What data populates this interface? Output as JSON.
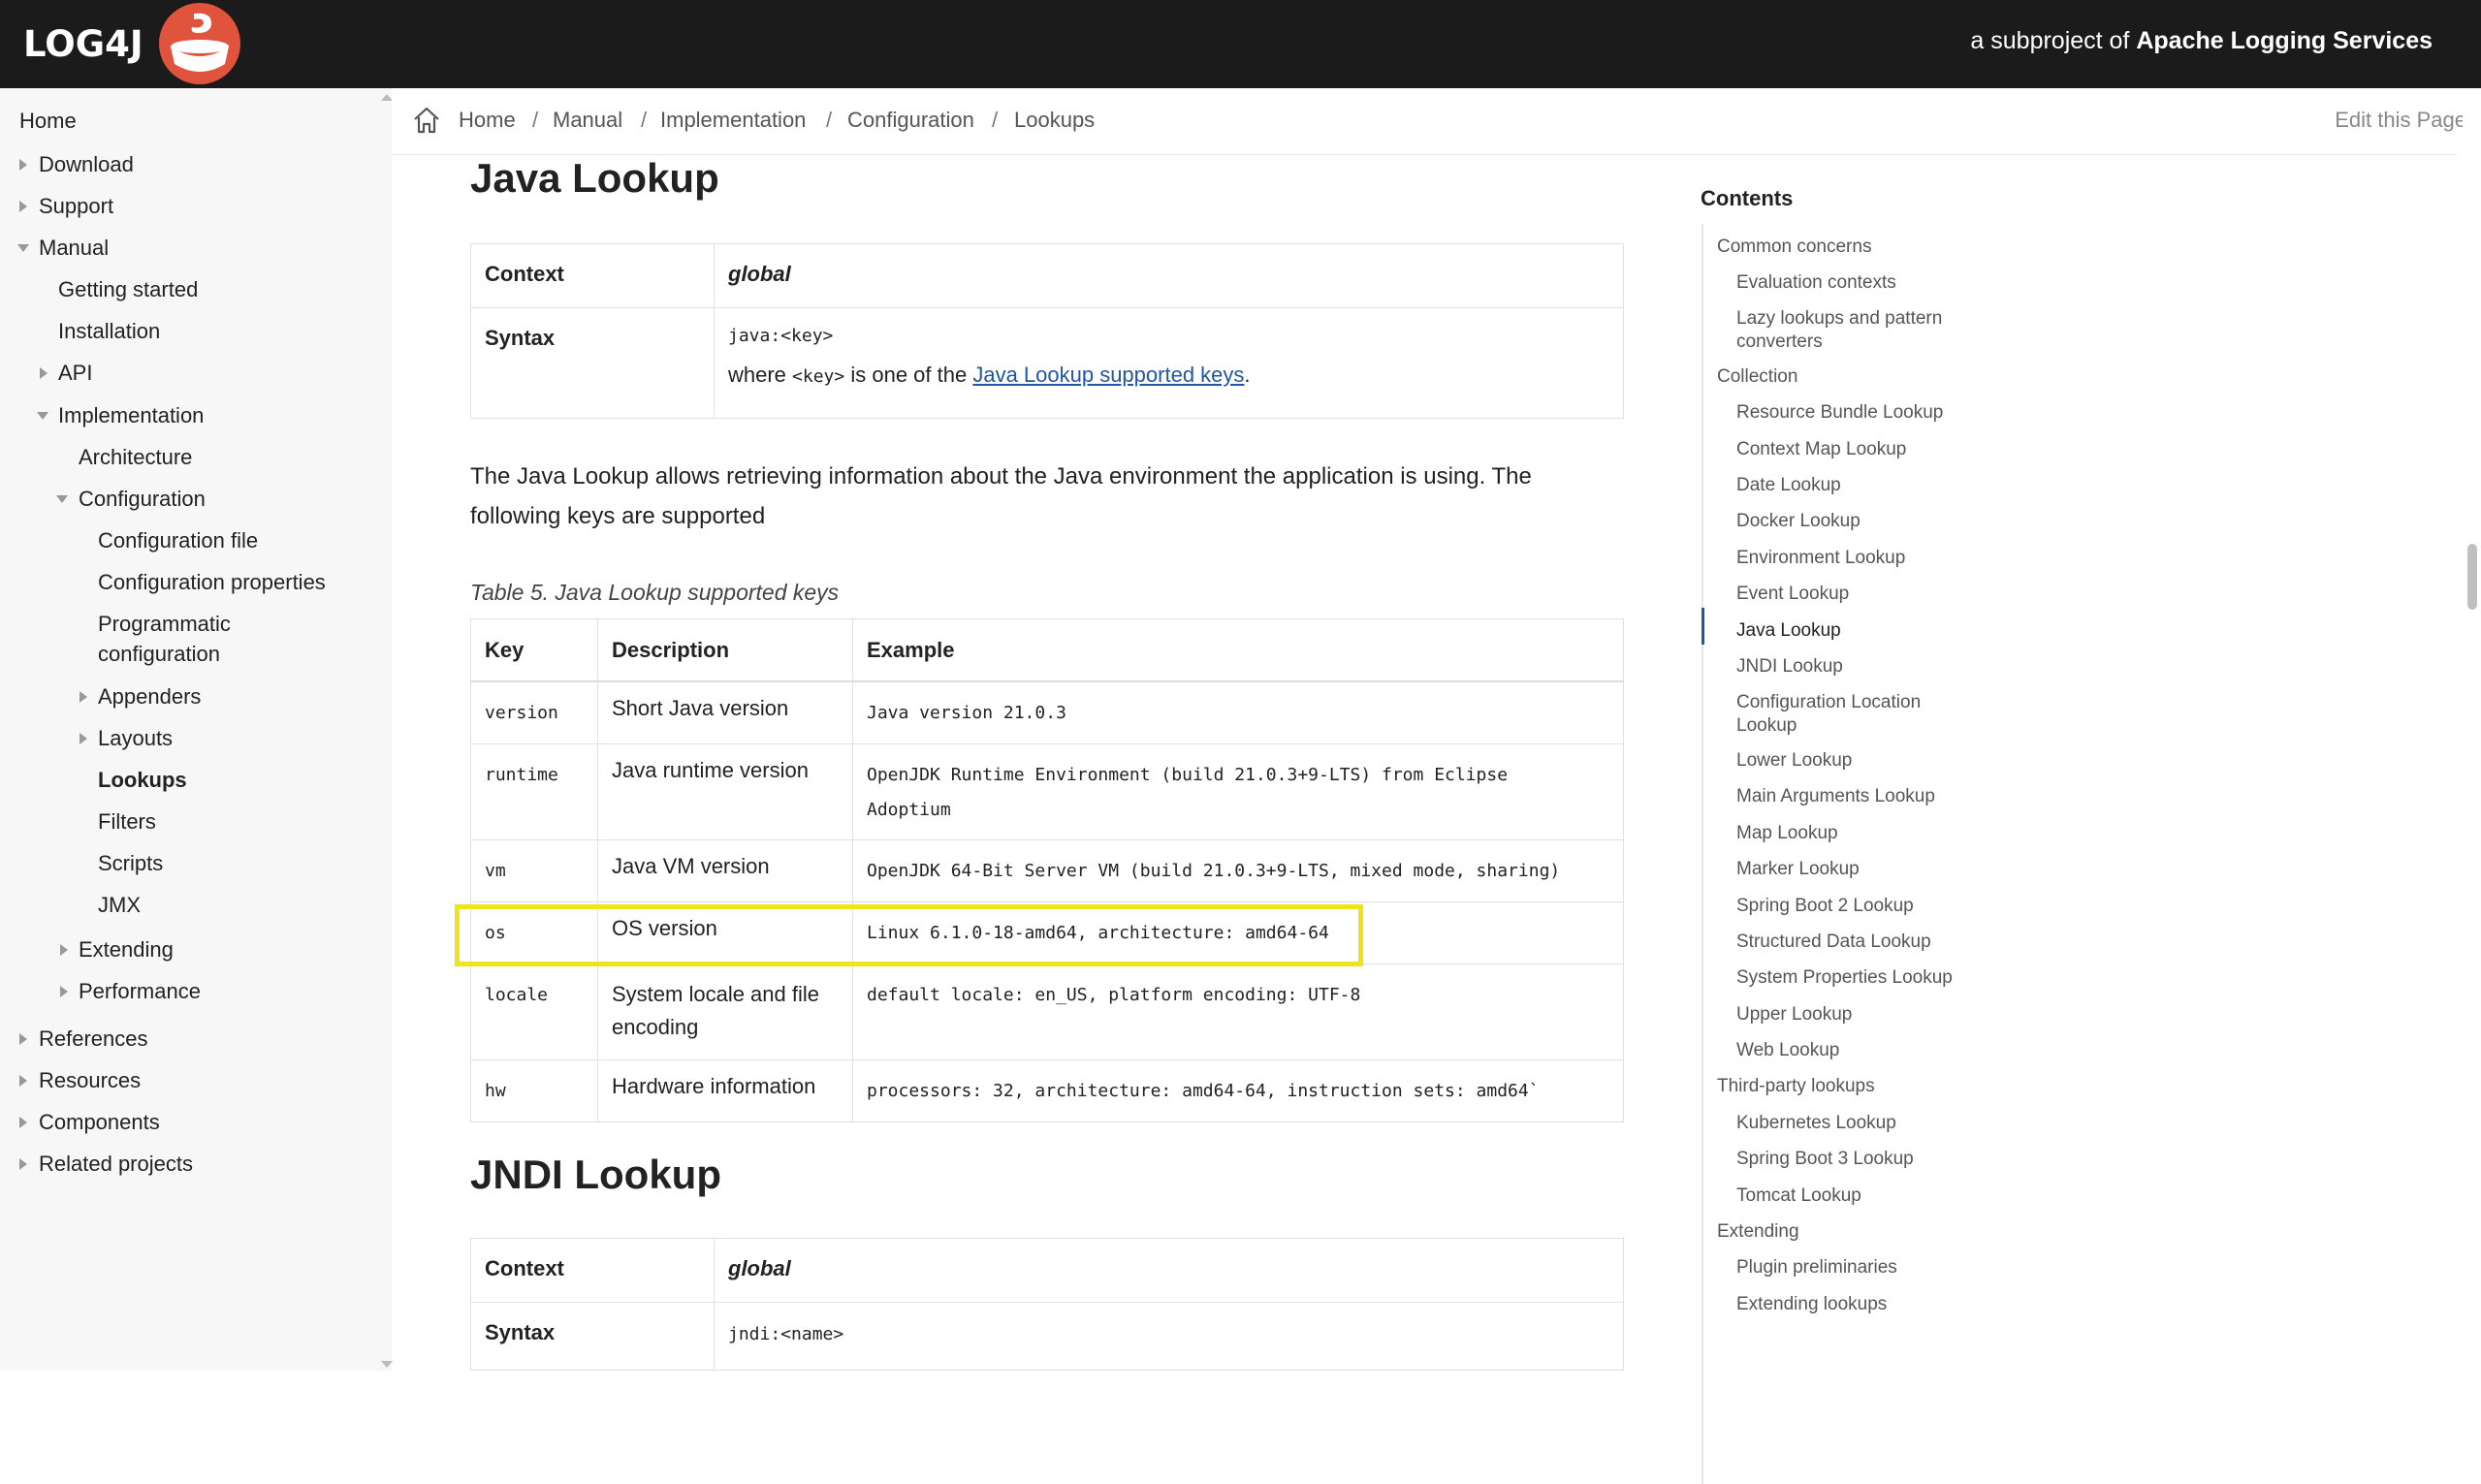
{
  "header": {
    "logo_text": "LOG4J",
    "subproject_prefix": "a subproject of ",
    "subproject_name": "Apache Logging Services"
  },
  "sidebar": {
    "home": "Home",
    "download": "Download",
    "support": "Support",
    "manual": "Manual",
    "getting_started": "Getting started",
    "installation": "Installation",
    "api": "API",
    "implementation": "Implementation",
    "architecture": "Architecture",
    "configuration": "Configuration",
    "configuration_file": "Configuration file",
    "configuration_properties": "Configuration properties",
    "programmatic_1": "Programmatic",
    "programmatic_2": "configuration",
    "appenders": "Appenders",
    "layouts": "Layouts",
    "lookups": "Lookups",
    "filters": "Filters",
    "scripts": "Scripts",
    "jmx": "JMX",
    "extending": "Extending",
    "performance": "Performance",
    "references": "References",
    "resources": "Resources",
    "components": "Components",
    "related_projects": "Related projects"
  },
  "breadcrumb": {
    "items": [
      "Home",
      "Manual",
      "Implementation",
      "Configuration",
      "Lookups"
    ],
    "separator": "/",
    "edit_page": "Edit this Page"
  },
  "java_lookup": {
    "title": "Java Lookup",
    "context_label": "Context",
    "context_value": "global",
    "syntax_label": "Syntax",
    "syntax_code": "java:<key>",
    "where_prefix": "where ",
    "where_code": "<key>",
    "where_middle": " is one of the ",
    "where_link": "Java Lookup supported keys",
    "where_suffix": ".",
    "description_line1": "The Java Lookup allows retrieving information about the Java environment the application is using. The",
    "description_line2": "following keys are supported",
    "table_caption": "Table 5. Java Lookup supported keys",
    "table_headers": [
      "Key",
      "Description",
      "Example"
    ],
    "rows": [
      {
        "key": "version",
        "desc": "Short Java version",
        "example": "Java version 21.0.3"
      },
      {
        "key": "runtime",
        "desc": "Java runtime version",
        "example": "OpenJDK Runtime Environment (build 21.0.3+9-LTS) from Eclipse",
        "example2": "Adoptium"
      },
      {
        "key": "vm",
        "desc": "Java VM version",
        "example": "OpenJDK 64-Bit Server VM (build 21.0.3+9-LTS, mixed mode, sharing)"
      },
      {
        "key": "os",
        "desc": "OS version",
        "example": "Linux 6.1.0-18-amd64, architecture: amd64-64"
      },
      {
        "key": "locale",
        "desc": "System locale and file",
        "desc2": "encoding",
        "example": "default locale: en_US, platform encoding: UTF-8"
      },
      {
        "key": "hw",
        "desc": "Hardware information",
        "example": "processors: 32, architecture: amd64-64, instruction sets: amd64`"
      }
    ]
  },
  "jndi_lookup": {
    "title": "JNDI Lookup",
    "context_label": "Context",
    "context_value": "global",
    "syntax_label": "Syntax",
    "syntax_code": "jndi:<name>"
  },
  "toc": {
    "title": "Contents",
    "items": [
      {
        "label": "Common concerns",
        "level": 1
      },
      {
        "label": "Evaluation contexts",
        "level": 2
      },
      {
        "label": "Lazy lookups and pattern",
        "label2": "converters",
        "level": 2
      },
      {
        "label": "Collection",
        "level": 1
      },
      {
        "label": "Resource Bundle Lookup",
        "level": 2
      },
      {
        "label": "Context Map Lookup",
        "level": 2
      },
      {
        "label": "Date Lookup",
        "level": 2
      },
      {
        "label": "Docker Lookup",
        "level": 2
      },
      {
        "label": "Environment Lookup",
        "level": 2
      },
      {
        "label": "Event Lookup",
        "level": 2
      },
      {
        "label": "Java Lookup",
        "level": 2,
        "active": true
      },
      {
        "label": "JNDI Lookup",
        "level": 2
      },
      {
        "label": "Configuration Location",
        "label2": "Lookup",
        "level": 2
      },
      {
        "label": "Lower Lookup",
        "level": 2
      },
      {
        "label": "Main Arguments Lookup",
        "level": 2
      },
      {
        "label": "Map Lookup",
        "level": 2
      },
      {
        "label": "Marker Lookup",
        "level": 2
      },
      {
        "label": "Spring Boot 2 Lookup",
        "level": 2
      },
      {
        "label": "Structured Data Lookup",
        "level": 2
      },
      {
        "label": "System Properties Lookup",
        "level": 2
      },
      {
        "label": "Upper Lookup",
        "level": 2
      },
      {
        "label": "Web Lookup",
        "level": 2
      },
      {
        "label": "Third-party lookups",
        "level": 1
      },
      {
        "label": "Kubernetes Lookup",
        "level": 2
      },
      {
        "label": "Spring Boot 3 Lookup",
        "level": 2
      },
      {
        "label": "Tomcat Lookup",
        "level": 2
      },
      {
        "label": "Extending",
        "level": 1
      },
      {
        "label": "Plugin preliminaries",
        "level": 2
      },
      {
        "label": "Extending lookups",
        "level": 2
      }
    ]
  },
  "colors": {
    "header_bg": "#1b1b1b",
    "link": "#2156a5",
    "highlight": "#f2e21a",
    "logo_red": "#e0533d"
  }
}
